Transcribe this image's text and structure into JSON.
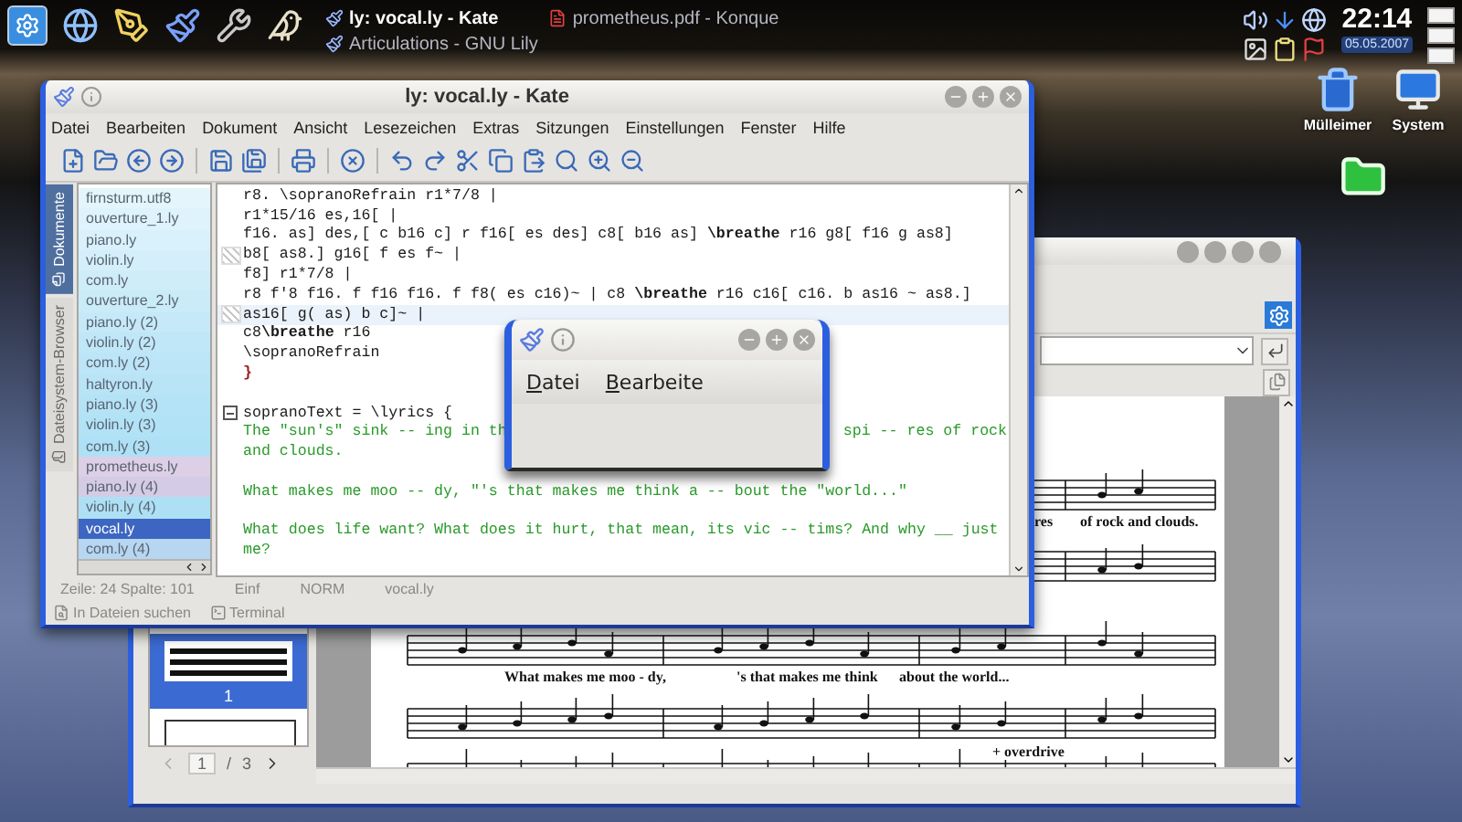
{
  "panel": {
    "tasks": [
      {
        "label": "ly: vocal.ly - Kate",
        "active": true
      },
      {
        "label": "Articulations - GNU Lily",
        "active": false
      },
      {
        "label": "prometheus.pdf - Konque",
        "active": false
      }
    ],
    "clock": "22:14",
    "date": "05.05.2007"
  },
  "desktop_icons": [
    {
      "kind": "trash",
      "label": "Mülleimer"
    },
    {
      "kind": "monitor",
      "label": "System"
    },
    {
      "kind": "folder"
    }
  ],
  "kate": {
    "title": "ly: vocal.ly - Kate",
    "menu": [
      "Datei",
      "Bearbeiten",
      "Dokument",
      "Ansicht",
      "Lesezeichen",
      "Extras",
      "Sitzungen",
      "Einstellungen",
      "Fenster",
      "Hilfe"
    ],
    "side_tabs": [
      {
        "label": "Dokumente",
        "selected": true
      },
      {
        "label": "Dateisystem-Browser",
        "selected": false
      }
    ],
    "files": [
      {
        "label": "firnsturm.utf8",
        "selected": false,
        "color": "#e4f5fb"
      },
      {
        "label": "ouverture_1.ly",
        "selected": false,
        "color": "#def3fb"
      },
      {
        "label": "piano.ly",
        "selected": false,
        "color": "#d9f1fa"
      },
      {
        "label": "violin.ly",
        "selected": false,
        "color": "#d4eff9"
      },
      {
        "label": "com.ly",
        "selected": false,
        "color": "#cfedf9"
      },
      {
        "label": "ouverture_2.ly",
        "selected": false,
        "color": "#caebf8"
      },
      {
        "label": "piano.ly (2)",
        "selected": false,
        "color": "#c5e9f8"
      },
      {
        "label": "violin.ly (2)",
        "selected": false,
        "color": "#c0e7f7"
      },
      {
        "label": "com.ly (2)",
        "selected": false,
        "color": "#bce5f7"
      },
      {
        "label": "haltyron.ly",
        "selected": false,
        "color": "#b8e4f6"
      },
      {
        "label": "piano.ly (3)",
        "selected": false,
        "color": "#b5e3f6"
      },
      {
        "label": "violin.ly (3)",
        "selected": false,
        "color": "#b2e2f6"
      },
      {
        "label": "com.ly (3)",
        "selected": false,
        "color": "#afe1f6"
      },
      {
        "label": "prometheus.ly",
        "selected": false,
        "color": "#dccfe6"
      },
      {
        "label": "piano.ly (4)",
        "selected": false,
        "color": "#d4cbe6"
      },
      {
        "label": "violin.ly (4)",
        "selected": false,
        "color": "#ade0f5"
      },
      {
        "label": "vocal.ly",
        "selected": true,
        "color": "#3c66c2"
      },
      {
        "label": "com.ly (4)",
        "selected": false,
        "color": "#b6d6f2"
      }
    ],
    "lines": [
      {
        "kind": "code",
        "text": "r8. \\sopranoRefrain r1*7/8 |",
        "marked": false,
        "current": false
      },
      {
        "kind": "code",
        "text": "r1*15/16 es,16[ |",
        "marked": false,
        "current": false
      },
      {
        "kind": "code",
        "text": "f16. as] des,[ c b16 c] r f16[ es des] c8[ b16 as] **\\breathe** r16 g8[ f16 g as8]",
        "marked": false,
        "current": false
      },
      {
        "kind": "code",
        "text": "b8[ as8.] g16[ f es f~ |",
        "marked": true,
        "current": false
      },
      {
        "kind": "code",
        "text": "f8] r1*7/8 |",
        "marked": false,
        "current": false
      },
      {
        "kind": "code",
        "text": "r8 f'8 f16. f f16 f16. f f8( es c16)~ | c8 **\\breathe** r16 c16[ c16. b as16 ~ as8.]",
        "marked": false,
        "current": false
      },
      {
        "kind": "code",
        "text": "as16[ g( as) b c]~ |",
        "marked": true,
        "current": true
      },
      {
        "kind": "code",
        "text": "c8**\\breathe** r16",
        "marked": false,
        "current": false
      },
      {
        "kind": "code",
        "text": "\\sopranoRefrain",
        "marked": false,
        "current": false
      },
      {
        "kind": "brace",
        "text": "}",
        "marked": false,
        "current": false
      },
      {
        "kind": "blank",
        "marked": false,
        "current": false
      },
      {
        "kind": "fold",
        "text": "sopranoText = \\lyrics {",
        "marked": false,
        "current": false
      },
      {
        "kind": "lyric",
        "segments": [
          "The \"sun's\" sink -- ing in th",
          "spi -- res of rock"
        ],
        "marked": false,
        "current": false
      },
      {
        "kind": "lyric",
        "text": "and clouds.",
        "marked": false,
        "current": false
      },
      {
        "kind": "blank",
        "marked": false,
        "current": false
      },
      {
        "kind": "lyric",
        "text": "What makes me moo -- dy, \"'s that makes me think a -- bout the \"world...\"",
        "marked": false,
        "current": false
      },
      {
        "kind": "blank",
        "marked": false,
        "current": false
      },
      {
        "kind": "lyric",
        "text": "What does life want? What does it hurt, that mean, its vic -- tims? And why __ just",
        "marked": false,
        "current": false
      },
      {
        "kind": "lyric",
        "text": "me?",
        "marked": false,
        "current": false
      }
    ],
    "status": [
      "Zeile: 24 Spalte: 101",
      "Einf",
      "NORM",
      "vocal.ly"
    ],
    "bottom_tabs": [
      {
        "kind": "search",
        "label": "In Dateien suchen"
      },
      {
        "kind": "terminal",
        "label": "Terminal"
      }
    ]
  },
  "popup": {
    "menu": [
      "Datei",
      "Bearbeite"
    ]
  },
  "konqueror": {
    "thumb_label": "1",
    "page_current": "1",
    "page_separator": "/",
    "page_total": "3",
    "lyrics": [
      "res",
      "of rock and clouds.",
      "What makes me moo - dy,",
      "'s that makes me think",
      "about the world...",
      "+ overdrive"
    ]
  }
}
